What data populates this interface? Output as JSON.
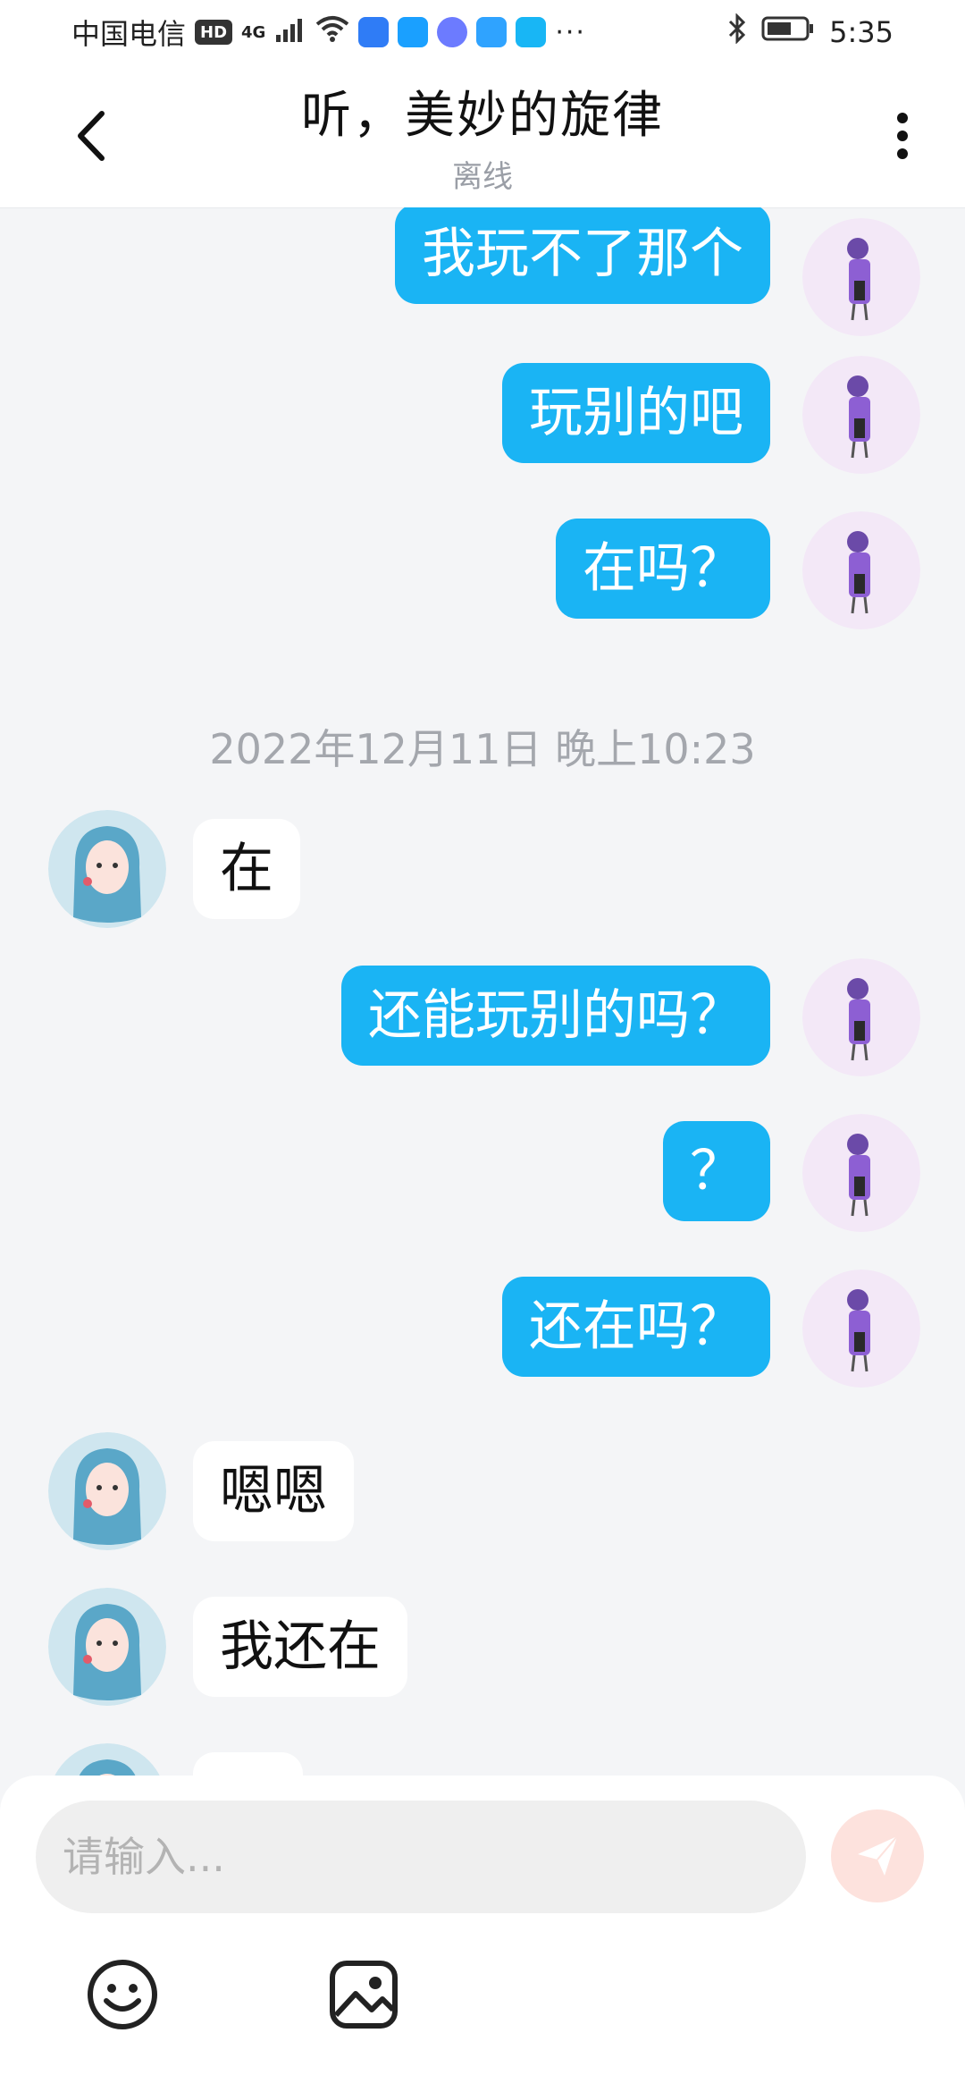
{
  "status_bar": {
    "carrier": "中国电信",
    "hd": "HD",
    "network": "4G",
    "more": "···",
    "time": "5:35",
    "app_icons": [
      "bluetooth-app-icon",
      "weather-app-icon",
      "music-app-icon",
      "store-app-icon",
      "browser-app-icon"
    ],
    "app_colors": [
      "#2f7cf6",
      "#1aa0ff",
      "#6c7bff",
      "#2fa3ff",
      "#18b6f5"
    ]
  },
  "header": {
    "title": "听，美妙的旋律",
    "status": "离线"
  },
  "messages": [
    {
      "side": "me",
      "text": "我玩不了那个"
    },
    {
      "side": "me",
      "text": "玩别的吧"
    },
    {
      "side": "me",
      "text": "在吗？"
    },
    {
      "timestamp": "2022年12月11日 晚上10:23"
    },
    {
      "side": "other",
      "text": "在"
    },
    {
      "side": "me",
      "text": "还能玩别的吗？"
    },
    {
      "side": "me",
      "text": "？"
    },
    {
      "side": "me",
      "text": "还在吗？"
    },
    {
      "side": "other",
      "text": "嗯嗯"
    },
    {
      "side": "other",
      "text": "我还在"
    },
    {
      "side": "other",
      "text": "😐"
    }
  ],
  "composer": {
    "placeholder": "请输入...",
    "value": ""
  },
  "colors": {
    "my_bubble": "#1ab4f4",
    "other_bubble": "#ffffff",
    "background": "#f4f5f7",
    "send_button": "#fde2dd"
  }
}
